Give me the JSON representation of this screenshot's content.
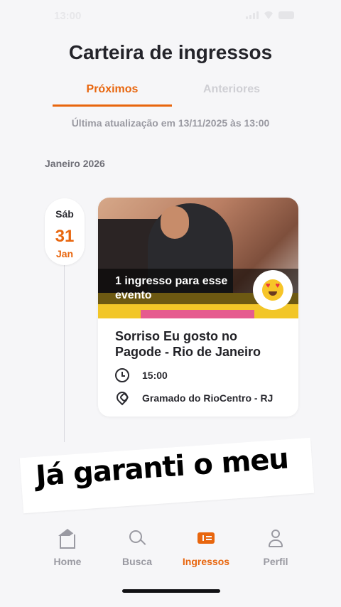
{
  "status_bar": {
    "time": "13:00"
  },
  "header": {
    "title": "Carteira de ingressos"
  },
  "tabs": [
    {
      "label": "Próximos",
      "active": true
    },
    {
      "label": "Anteriores",
      "active": false
    }
  ],
  "last_update": "Última atualização em 13/11/2025 às 13:00",
  "month_group": "Janeiro 2026",
  "event": {
    "date": {
      "weekday": "Sáb",
      "day": "31",
      "month": "Jan"
    },
    "ticket_count_text": "1 ingresso para esse evento",
    "title": "Sorriso Eu gosto no Pagode - Rio de Janeiro",
    "time": "15:00",
    "venue": "Gramado do RioCentro - RJ",
    "emoji_icon": "heart-eyes-emoji-icon"
  },
  "caption_overlay": "Já garanti o meu",
  "bottom_nav": [
    {
      "label": "Home",
      "icon": "home-icon",
      "active": false
    },
    {
      "label": "Busca",
      "icon": "search-icon",
      "active": false
    },
    {
      "label": "Ingressos",
      "icon": "ticket-icon",
      "active": true
    },
    {
      "label": "Perfil",
      "icon": "person-icon",
      "active": false
    }
  ],
  "colors": {
    "accent": "#e8660e",
    "background": "#f6f6f8",
    "muted": "#9a9aa2"
  }
}
